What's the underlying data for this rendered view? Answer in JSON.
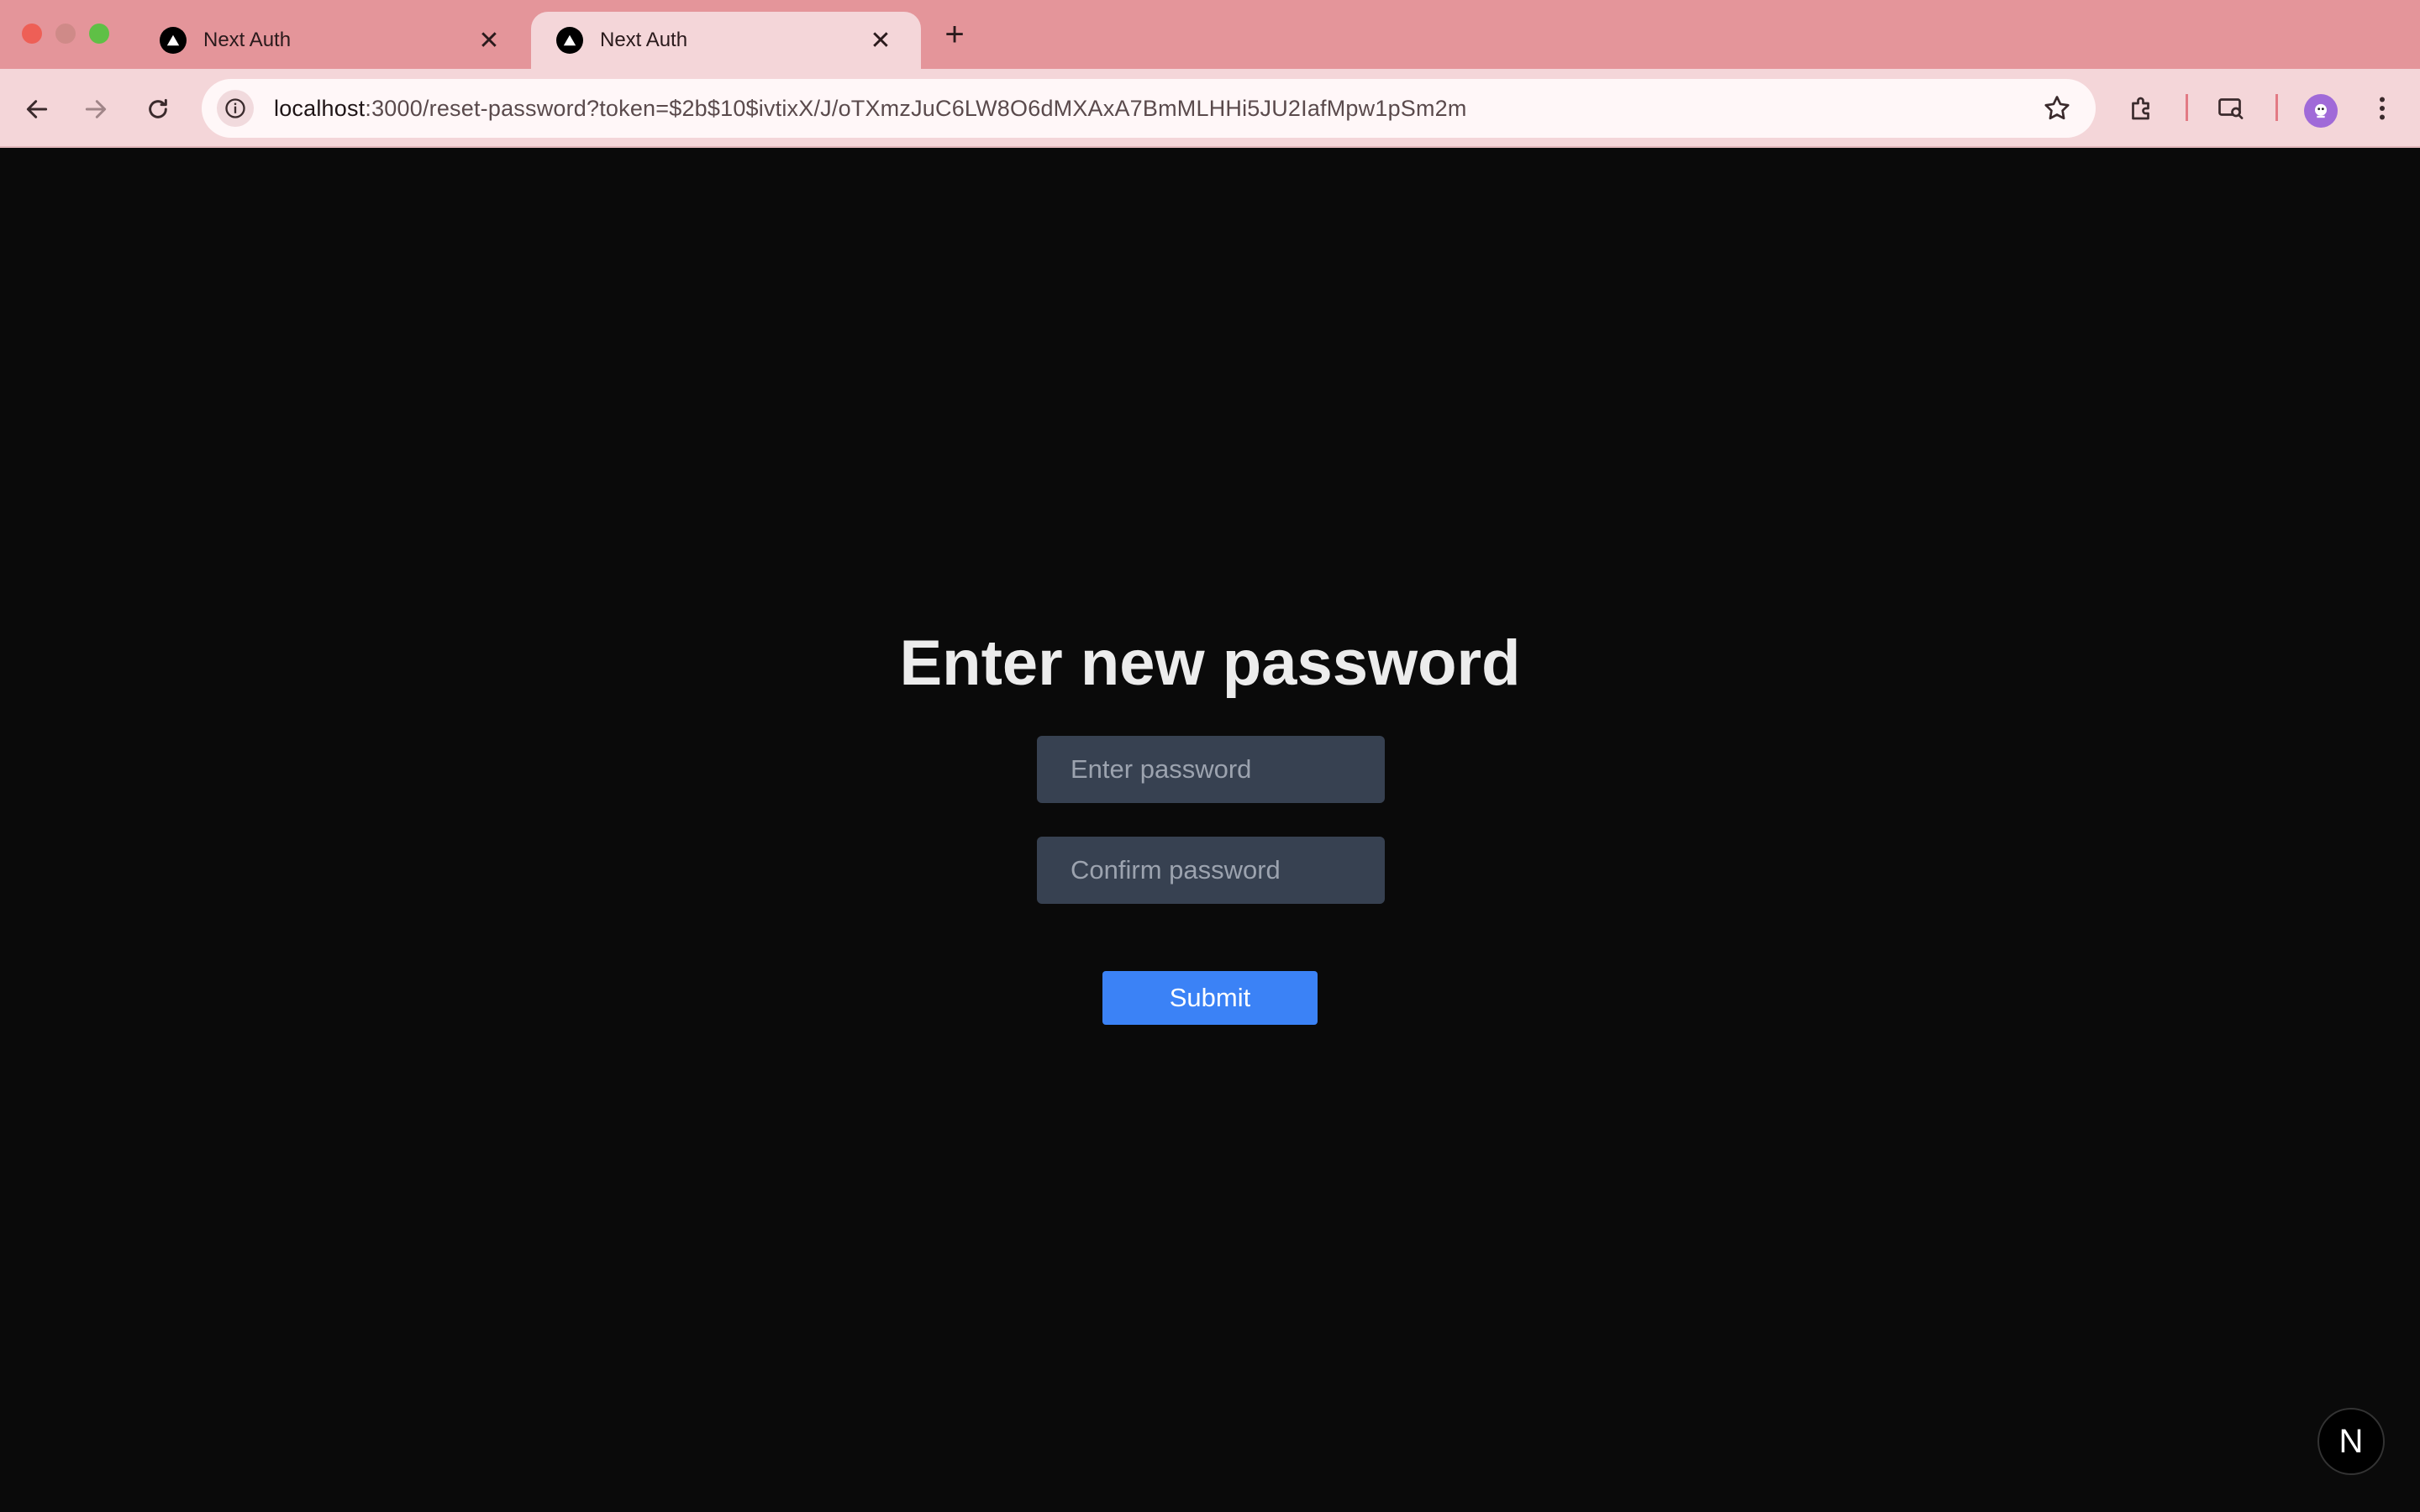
{
  "browser": {
    "tabs": [
      {
        "title": "Next Auth",
        "active": false
      },
      {
        "title": "Next Auth",
        "active": true
      }
    ],
    "new_tab_label": "+",
    "close_glyph": "✕",
    "url_host": "localhost",
    "url_rest": ":3000/reset-password?token=$2b$10$ivtixX/J/oTXmzJuC6LW8O6dMXAxA7BmMLHHi5JU2IafMpw1pSm2m",
    "icons": [
      "back-icon",
      "forward-icon",
      "reload-icon",
      "site-info-icon",
      "bookmark-star-icon",
      "extensions-icon",
      "cast-search-icon",
      "profile-avatar-icon",
      "kebab-menu-icon"
    ]
  },
  "page": {
    "heading": "Enter new password",
    "password_placeholder": "Enter password",
    "confirm_placeholder": "Confirm password",
    "submit_label": "Submit",
    "dev_badge": "N"
  },
  "colors": {
    "background": "#0a0a0a",
    "input_bg": "#374151",
    "button": "#3b82f6",
    "tabstrip": "#e4959a"
  }
}
